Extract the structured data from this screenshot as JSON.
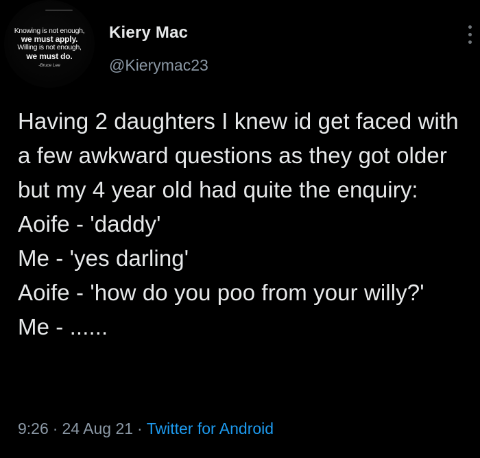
{
  "user": {
    "display_name": "Kiery Mac",
    "handle": "@Kierymac23",
    "avatar_quote": {
      "line1": "Knowing is not enough,",
      "line2": "we must apply.",
      "line3": "Willing is not enough,",
      "line4": "we must do.",
      "attribution": "-Bruce Lee"
    }
  },
  "tweet": {
    "text": "Having 2 daughters I knew id get faced with a few awkward questions as they got older but my 4 year old had quite the enquiry:\nAoife - 'daddy'\nMe - 'yes darling'\nAoife - 'how do you poo from your willy?'\nMe - ......",
    "time": "9:26",
    "date": "24 Aug 21",
    "separator": "·",
    "source": "Twitter for Android"
  },
  "icons": {
    "more": "more-vertical-icon"
  },
  "colors": {
    "background": "#000000",
    "text": "#e7e9ea",
    "muted": "#8b98a5",
    "link": "#1d9bf0"
  }
}
